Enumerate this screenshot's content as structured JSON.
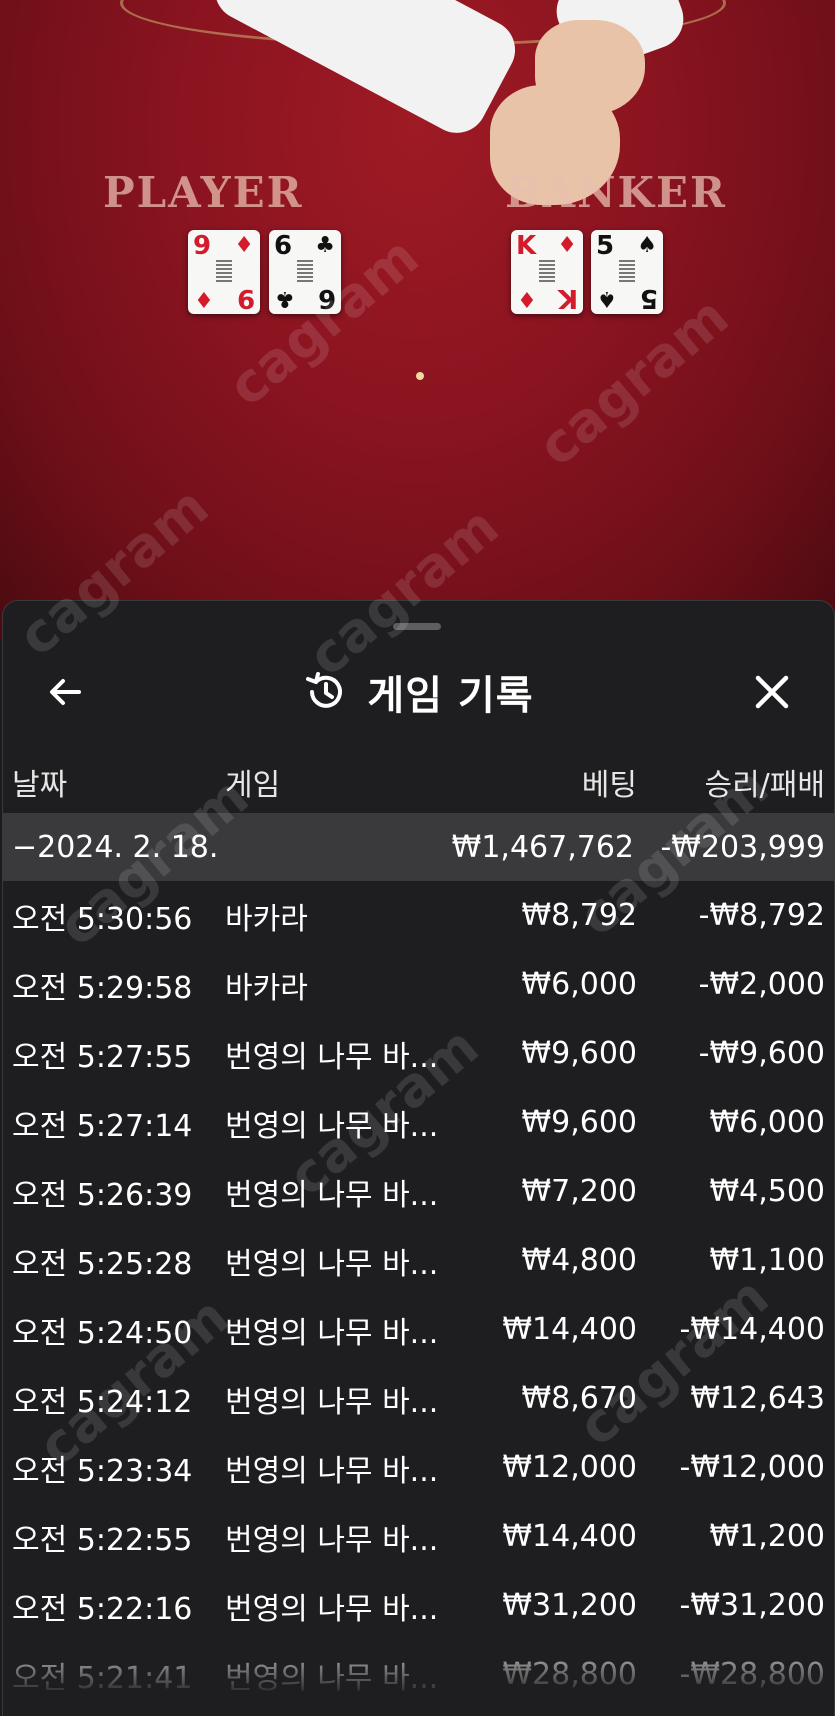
{
  "table": {
    "player_label": "PLAYER",
    "banker_label": "BANKER",
    "player_cards": [
      {
        "rank": "9",
        "suit": "♦",
        "color": "red"
      },
      {
        "rank": "6",
        "suit": "♣",
        "color": "black"
      }
    ],
    "banker_cards": [
      {
        "rank": "K",
        "suit": "♦",
        "color": "red"
      },
      {
        "rank": "5",
        "suit": "♠",
        "color": "black"
      }
    ],
    "felt_color": "#8a1420"
  },
  "sheet": {
    "title": "게임 기록",
    "back_icon": "arrow-left-icon",
    "history_icon": "history-icon",
    "close_icon": "close-icon",
    "columns": {
      "date": "날짜",
      "game": "게임",
      "bet": "베팅",
      "win_loss": "승리/패배"
    },
    "group": {
      "date": "−2024. 2. 18.",
      "bet": "₩1,467,762",
      "win_loss": "-₩203,999"
    },
    "rows": [
      {
        "time": "오전 5:30:56",
        "game": "바카라",
        "bet": "₩8,792",
        "win_loss": "-₩8,792"
      },
      {
        "time": "오전 5:29:58",
        "game": "바카라",
        "bet": "₩6,000",
        "win_loss": "-₩2,000"
      },
      {
        "time": "오전 5:27:55",
        "game": "번영의 나무 바...",
        "bet": "₩9,600",
        "win_loss": "-₩9,600"
      },
      {
        "time": "오전 5:27:14",
        "game": "번영의 나무 바...",
        "bet": "₩9,600",
        "win_loss": "₩6,000"
      },
      {
        "time": "오전 5:26:39",
        "game": "번영의 나무 바...",
        "bet": "₩7,200",
        "win_loss": "₩4,500"
      },
      {
        "time": "오전 5:25:28",
        "game": "번영의 나무 바...",
        "bet": "₩4,800",
        "win_loss": "₩1,100"
      },
      {
        "time": "오전 5:24:50",
        "game": "번영의 나무 바...",
        "bet": "₩14,400",
        "win_loss": "-₩14,400"
      },
      {
        "time": "오전 5:24:12",
        "game": "번영의 나무 바...",
        "bet": "₩8,670",
        "win_loss": "₩12,643"
      },
      {
        "time": "오전 5:23:34",
        "game": "번영의 나무 바...",
        "bet": "₩12,000",
        "win_loss": "-₩12,000"
      },
      {
        "time": "오전 5:22:55",
        "game": "번영의 나무 바...",
        "bet": "₩14,400",
        "win_loss": "₩1,200"
      },
      {
        "time": "오전 5:22:16",
        "game": "번영의 나무 바...",
        "bet": "₩31,200",
        "win_loss": "-₩31,200"
      },
      {
        "time": "오전 5:21:41",
        "game": "번영의 나무 바...",
        "bet": "₩28,800",
        "win_loss": "-₩28,800"
      }
    ]
  },
  "watermark": "cagram"
}
